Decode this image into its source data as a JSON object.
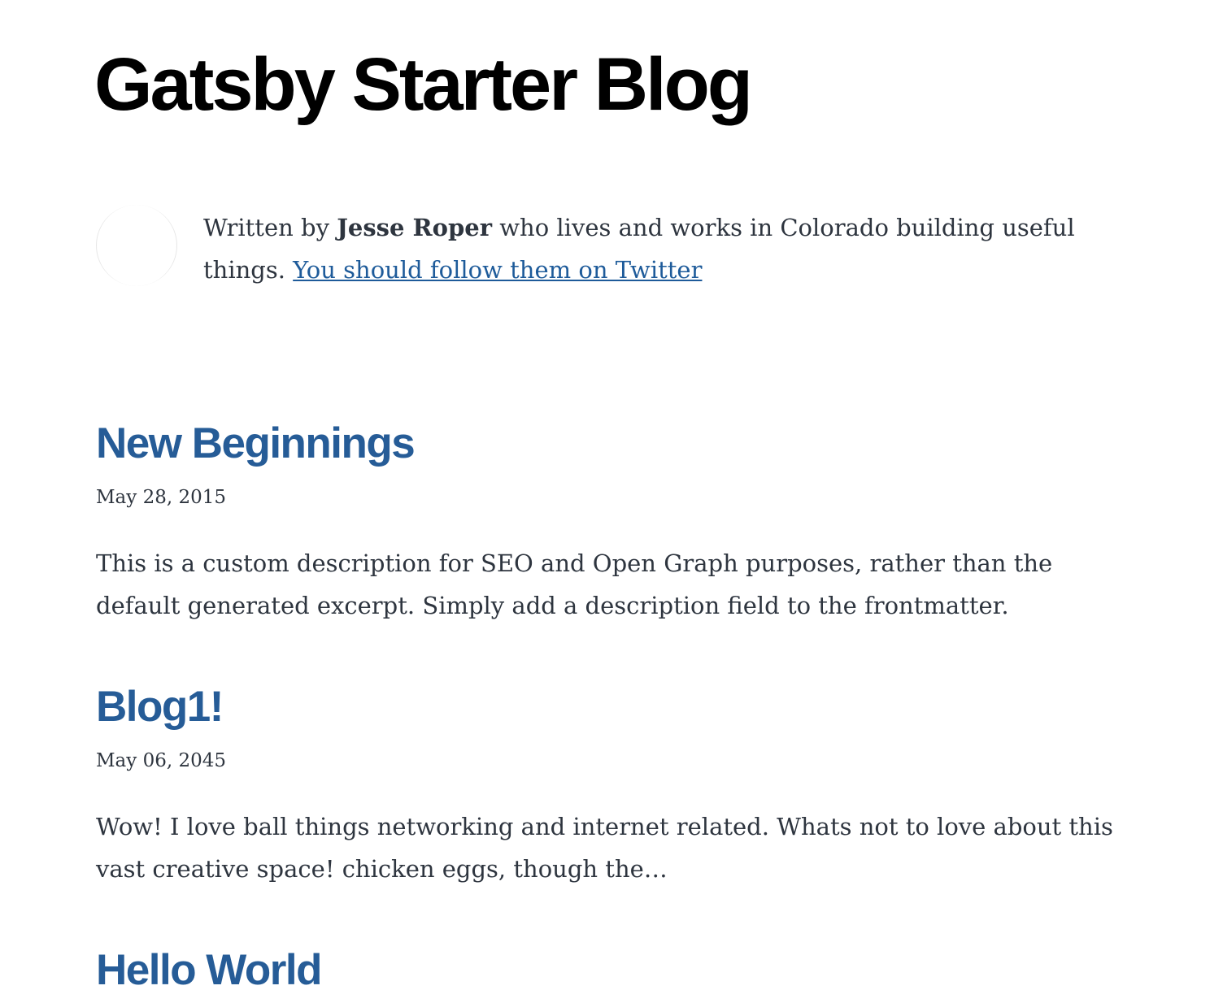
{
  "site": {
    "title": "Gatsby Starter Blog"
  },
  "bio": {
    "prefix": "Written by ",
    "author": "Jesse Roper",
    "suffix": " who lives and works in Colorado building useful things. ",
    "twitter_link": "You should follow them on Twitter"
  },
  "posts": [
    {
      "title": "New Beginnings",
      "date": "May 28, 2015",
      "excerpt": "This is a custom description for SEO and Open Graph purposes, rather than the default generated excerpt. Simply add a description field to the frontmatter."
    },
    {
      "title": "Blog1!",
      "date": "May 06, 2045",
      "excerpt": "Wow! I love ball things networking and internet related. Whats not to love about this vast creative space! chicken eggs, though the…"
    },
    {
      "title": "Hello World"
    }
  ],
  "colors": {
    "title": "#000000",
    "post_link": "#265c97",
    "body_text": "#2e353f"
  }
}
